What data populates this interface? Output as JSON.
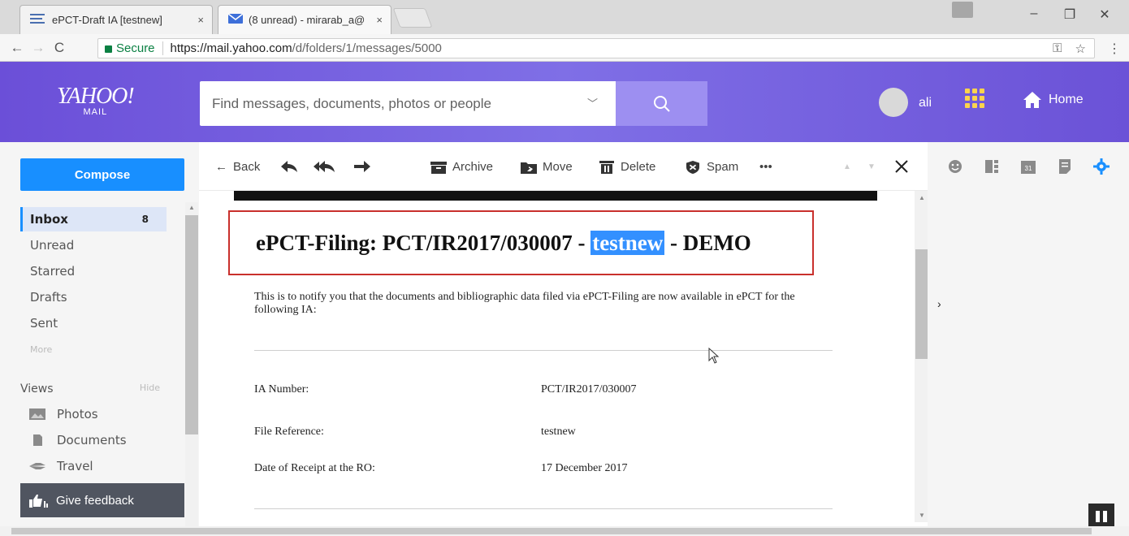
{
  "browser": {
    "tabs": [
      {
        "title": "ePCT-Draft IA [testnew]",
        "close": "×"
      },
      {
        "title": "(8 unread) - mirarab_a@",
        "close": "×"
      }
    ],
    "window_controls": {
      "minimize": "–",
      "maximize": "❐",
      "close": "✕"
    },
    "nav": {
      "back": "←",
      "forward": "→",
      "reload": "C"
    },
    "address": {
      "secure_label": "Secure",
      "domain": "https://mail.yahoo.com",
      "path": "/d/folders/1/messages/5000"
    }
  },
  "header": {
    "logo_main": "YAHOO!",
    "logo_sub": "MAIL",
    "search_placeholder": "Find messages, documents, photos or people",
    "user_name": "ali",
    "home_label": "Home",
    "accent_color": "#6b4fd8"
  },
  "sidebar": {
    "compose_label": "Compose",
    "folders": [
      {
        "label": "Inbox",
        "count": "8"
      },
      {
        "label": "Unread"
      },
      {
        "label": "Starred"
      },
      {
        "label": "Drafts"
      },
      {
        "label": "Sent"
      },
      {
        "label": "More"
      }
    ],
    "views_label": "Views",
    "views_hide": "Hide",
    "views": [
      {
        "label": "Photos",
        "icon": "photo-icon"
      },
      {
        "label": "Documents",
        "icon": "document-icon"
      },
      {
        "label": "Travel",
        "icon": "plane-icon"
      }
    ],
    "feedback_label": "Give feedback"
  },
  "toolbar": {
    "back_label": "Back",
    "archive_label": "Archive",
    "move_label": "Move",
    "delete_label": "Delete",
    "spam_label": "Spam",
    "more_label": "•••"
  },
  "message": {
    "subject_prefix": "ePCT-Filing: PCT/IR2017/030007 - ",
    "subject_highlight": "testnew",
    "subject_suffix": " - DEMO",
    "notice": "This is to notify you that the documents and bibliographic data filed via ePCT-Filing are now available in ePCT for the following IA:",
    "fields": [
      {
        "label": "IA Number:",
        "value": "PCT/IR2017/030007"
      },
      {
        "label": "File Reference:",
        "value": "testnew"
      },
      {
        "label": "Date of Receipt at the RO:",
        "value": "17 December 2017"
      }
    ]
  }
}
